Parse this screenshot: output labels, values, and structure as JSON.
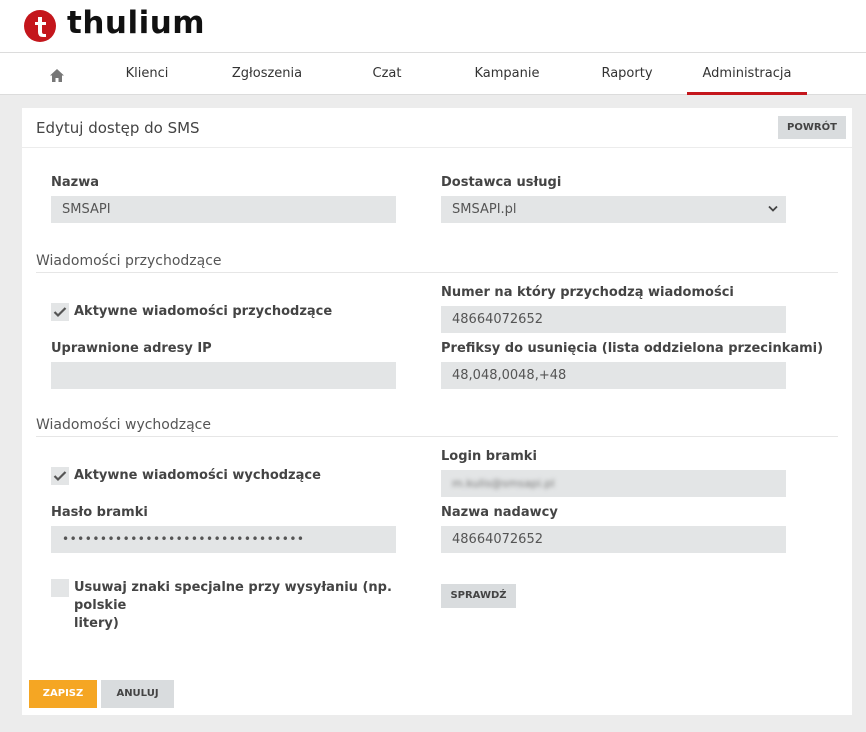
{
  "brand": {
    "name": "thulium",
    "color": "#c4161c"
  },
  "nav": {
    "home_icon": "home-icon",
    "items": [
      "Klienci",
      "Zgłoszenia",
      "Czat",
      "Kampanie",
      "Raporty",
      "Administracja"
    ],
    "active": "Administracja"
  },
  "panel": {
    "title": "Edytuj dostęp do SMS",
    "back_label": "POWRÓT"
  },
  "form": {
    "name_label": "Nazwa",
    "name_value": "SMSAPI",
    "provider_label": "Dostawca usługi",
    "provider_value": "SMSAPI.pl",
    "incoming": {
      "section": "Wiadomości przychodzące",
      "active_label": "Aktywne wiadomości przychodzące",
      "active_checked": true,
      "number_label": "Numer na który przychodzą wiadomości",
      "number_value": "48664072652",
      "ip_label": "Uprawnione adresy IP",
      "ip_value": "",
      "prefix_label": "Prefiksy do usunięcia (lista oddzielona przecinkami)",
      "prefix_value": "48,048,0048,+48"
    },
    "outgoing": {
      "section": "Wiadomości wychodzące",
      "active_label": "Aktywne wiadomości wychodzące",
      "active_checked": true,
      "login_label": "Login bramki",
      "login_value": "m.kulis@smsapi.pl",
      "password_label": "Hasło bramki",
      "password_value": "••••••••••••••••••••••••••••••••",
      "sender_label": "Nazwa nadawcy",
      "sender_value": "48664072652",
      "special_label_line1": "Usuwaj znaki specjalne przy wysyłaniu (np. polskie",
      "special_label_line2": "litery)",
      "special_checked": false,
      "check_button": "SPRAWDŹ"
    }
  },
  "actions": {
    "save": "ZAPISZ",
    "cancel": "ANULUJ"
  }
}
